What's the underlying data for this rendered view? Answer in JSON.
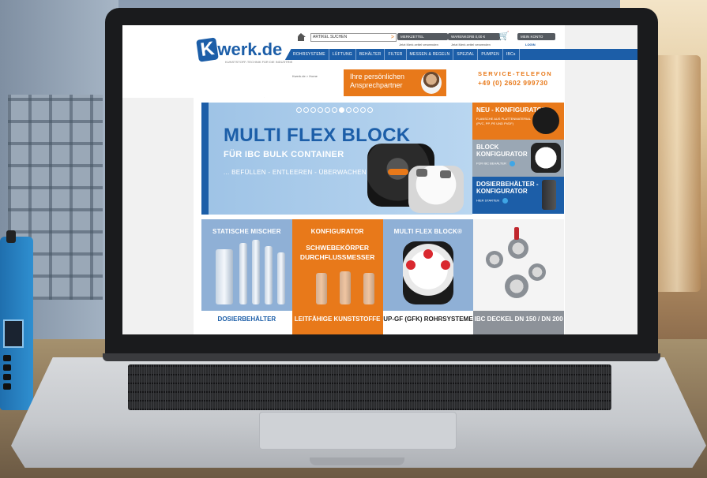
{
  "site": {
    "logo_text": "Kwerk.de",
    "logo_k": "K",
    "logo_rest": "werk.de",
    "logo_tagline": "KUNSTSTOFF-TECHNIK FÜR DIE INDUSTRIE",
    "search_placeholder": "ARTIKEL SUCHEN",
    "search_go": ">",
    "top_buttons": [
      "MERKZETTEL",
      "WARENKORB 0,00 €",
      "MEIN KONTO"
    ],
    "top_sub": [
      "Jetzt Merk zettel verwenden",
      "Jetzt Merk zettel verwenden",
      "LOGIN"
    ],
    "nav": [
      "ROHRSYSTEME",
      "LÜFTUNG",
      "BEHÄLTER",
      "FILTER",
      "MESSEN & REGELN",
      "SPEZIAL",
      "PUMPEN",
      "IBCs"
    ],
    "breadcrumb": "Kwerk.de > Home",
    "contact_line1": "Ihre persönlichen",
    "contact_line2": "Ansprechpartner",
    "service_label": "SERVICE-TELEFON",
    "service_number": "+49 (0) 2602 999730"
  },
  "hero": {
    "title": "MULTI FLEX BLOCK",
    "subtitle": "FÜR IBC BULK CONTAINER",
    "line": "... BEFÜLLEN - ENTLEEREN - ÜBERWACHEN",
    "dots_total": 11,
    "dots_active": 6
  },
  "side_tiles": [
    {
      "title": "NEU - KONFIGURATOR",
      "sub": "FLANSCHE AUS PLATTENMATERIAL (PVC, PP, PE UND PVDF)",
      "color": "#e8791a"
    },
    {
      "title": "BLOCK KONFIGURATOR",
      "sub": "FÜR IBC BEHÄLTER",
      "color": "#9aa7b4"
    },
    {
      "title": "DOSIERBEHÄLTER - KONFIGURATOR",
      "sub": "HIER STARTEN",
      "color": "#1c5ea8"
    }
  ],
  "categories": [
    {
      "label": "STATISCHE MISCHER",
      "color": "#8fb0d6"
    },
    {
      "label": "KONFIGURATOR",
      "label2": "SCHWEBEKÖRPER DURCHFLUSSMESSER",
      "color": "#e8791a"
    },
    {
      "label": "MULTI FLEX BLOCK®",
      "color": "#8fb0d6"
    },
    {
      "label": "",
      "color": "#f4f4f4"
    }
  ],
  "categories_row2": [
    {
      "label": "DOSIERBEHÄLTER",
      "bg": "#ffffff",
      "fg": "#1c5ea8"
    },
    {
      "label": "LEITFÄHIGE KUNSTSTOFFE",
      "bg": "#e8791a",
      "fg": "#ffffff"
    },
    {
      "label": "UP-GF (GFK) ROHRSYSTEME",
      "bg": "#ffffff",
      "fg": "#222222"
    },
    {
      "label": "IBC DECKEL DN 150 / DN 200",
      "bg": "#8d9299",
      "fg": "#ffffff"
    }
  ],
  "colors": {
    "brand_blue": "#1c5ea8",
    "accent_orange": "#e8791a"
  }
}
